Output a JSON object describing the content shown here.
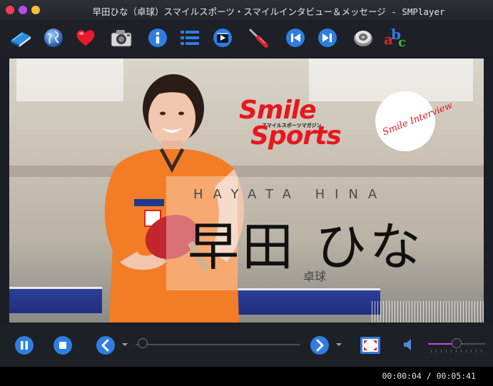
{
  "window": {
    "title": "早田ひな（卓球）スマイルスポーツ・スマイルインタビュー＆メッセージ - SMPlayer"
  },
  "toolbar": {
    "buttons": [
      {
        "name": "open-file",
        "icon": "book-icon"
      },
      {
        "name": "open-url",
        "icon": "globe-icon"
      },
      {
        "name": "favorites",
        "icon": "heart-icon"
      },
      {
        "name": "screenshot",
        "icon": "camera-icon"
      },
      {
        "name": "info",
        "icon": "info-icon"
      },
      {
        "name": "playlist",
        "icon": "list-icon"
      },
      {
        "name": "video-settings",
        "icon": "film-icon"
      },
      {
        "name": "preferences",
        "icon": "screwdriver-icon"
      },
      {
        "name": "previous",
        "icon": "skip-back-icon"
      },
      {
        "name": "next",
        "icon": "skip-forward-icon"
      },
      {
        "name": "audio",
        "icon": "speaker-icon"
      },
      {
        "name": "subtitles",
        "icon": "abc-icon"
      }
    ]
  },
  "video": {
    "logo_line1": "Smile",
    "logo_line2": "Sports",
    "logo_sub": "スマイルスポーツマガジン",
    "badge_text": "Smile Interview",
    "name_roman": "HAYATA HINA",
    "name_jp": "早田 ひな",
    "sport": "卓球"
  },
  "controls": {
    "seek_position": 0.012,
    "volume_level": 0.5
  },
  "status": {
    "time": "00:00:04 / 00:05:41"
  },
  "colors": {
    "accent_blue": "#2f7de1",
    "logo_red": "#e8161f",
    "volume_purple": "#c64bdc"
  }
}
